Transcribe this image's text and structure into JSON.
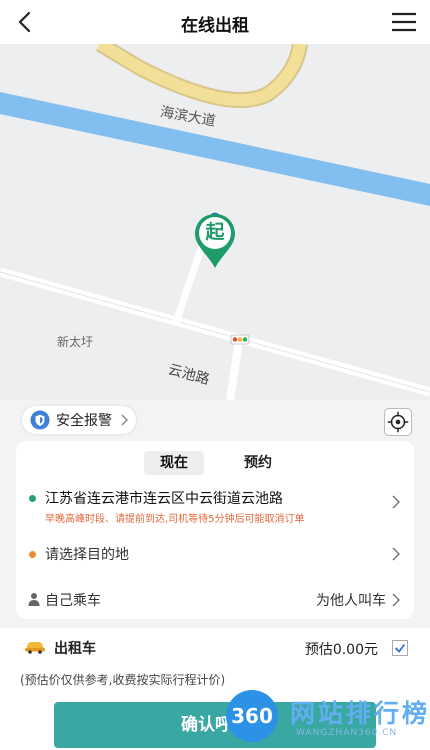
{
  "header": {
    "title": "在线出租",
    "back_icon": "back-arrow-icon",
    "menu_icon": "menu-icon"
  },
  "map": {
    "labels": {
      "haibin": "海滨大道",
      "xintai": "新太圩",
      "yunchi": "云池路"
    },
    "pin_text": "起",
    "colors": {
      "water": "#82bff0",
      "road_major": "#f2df98",
      "pin": "#1f9b6a",
      "current_location": "#2a6fe0"
    }
  },
  "safety": {
    "label": "安全报警",
    "icon": "shield-icon",
    "locate_icon": "locate-icon"
  },
  "trip": {
    "tabs": [
      {
        "label": "现在",
        "active": true
      },
      {
        "label": "预约",
        "active": false
      }
    ],
    "from": {
      "address": "江苏省连云港市连云区中云街道云池路",
      "warning": "早晚高峰时段、请提前到达,司机等待5分钟后可能取消订单"
    },
    "to": {
      "placeholder": "请选择目的地"
    },
    "rider": {
      "self_label": "自己乘车",
      "other_label": "为他人叫车"
    }
  },
  "service": {
    "name": "出租车",
    "estimate": "预估0.00元",
    "note": "(预估价仅供参考,收费按实际行程计价)",
    "confirm_label": "确认呼叫",
    "selected": true
  },
  "watermark": {
    "badge": "360",
    "title": "网站排行榜",
    "sub": "WANGZHAN360.CN"
  }
}
